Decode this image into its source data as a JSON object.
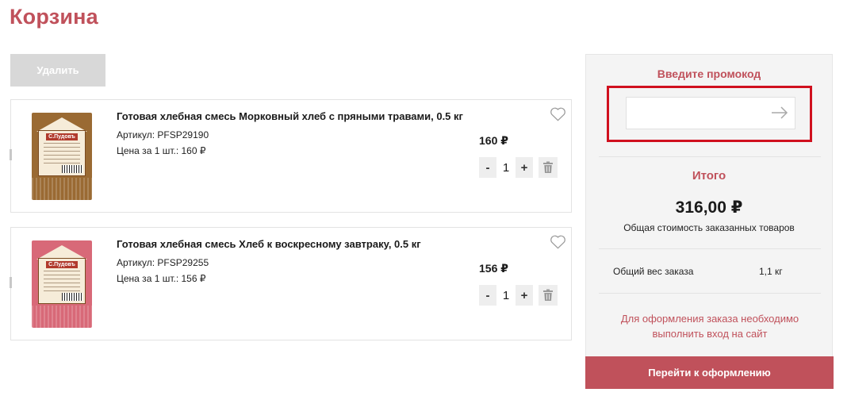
{
  "page": {
    "title": "Корзина"
  },
  "actions": {
    "delete_label": "Удалить"
  },
  "items": [
    {
      "name": "Готовая хлебная смесь Морковный хлеб с пряными травами, 0.5 кг",
      "sku": "Артикул: PFSP29190",
      "unit_price": "Цена за 1 шт.: 160 ₽",
      "price": "160 ₽",
      "quantity": "1",
      "image_brand": "С.Пудовъ",
      "pack_color": "#9a6a33",
      "icons": {
        "favorite": "heart-icon",
        "remove": "trash-icon"
      }
    },
    {
      "name": "Готовая хлебная смесь Хлеб к воскресному завтраку, 0.5 кг",
      "sku": "Артикул: PFSP29255",
      "unit_price": "Цена за 1 шт.: 156 ₽",
      "price": "156 ₽",
      "quantity": "1",
      "image_brand": "С.Пудовъ",
      "pack_color": "#d86978",
      "icons": {
        "favorite": "heart-icon",
        "remove": "trash-icon"
      }
    }
  ],
  "qty_controls": {
    "minus": "-",
    "plus": "+"
  },
  "summary": {
    "promo_title": "Введите промокод",
    "promo_value": "",
    "promo_placeholder": "",
    "total_title": "Итого",
    "total_sum": "316,00 ₽",
    "total_desc": "Общая стоимость заказанных товаров",
    "weight_label": "Общий вес заказа",
    "weight_value": "1,1 кг",
    "login_note": "Для оформления заказа необходимо выполнить вход на сайт",
    "checkout_label": "Перейти к оформлению"
  },
  "colors": {
    "accent": "#c0515b",
    "highlight_border": "#d0101e",
    "delete_button_bg": "#d8d8d8",
    "summary_bg": "#f4f4f4"
  }
}
